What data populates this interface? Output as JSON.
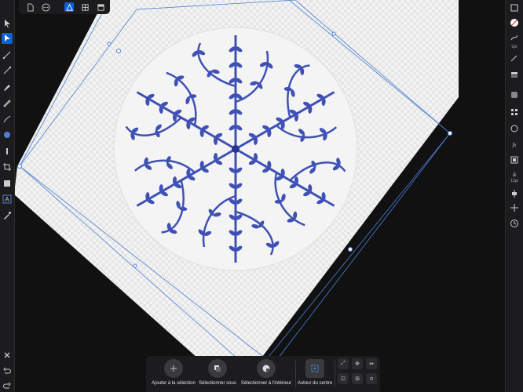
{
  "colors": {
    "accent": "#3b82f6",
    "ornament": "#3f51b5",
    "panel": "#1c1c1e",
    "canvas": "#111111"
  },
  "left_toolbar": {
    "tools": [
      "move-tool-icon",
      "node-tool-icon",
      "corner-tool-icon",
      "point-transform-icon",
      "pen-tool-icon",
      "pencil-tool-icon",
      "vector-brush-icon",
      "fill-tool-icon",
      "transparency-tool-icon",
      "crop-tool-icon",
      "rectangle-tool-icon",
      "text-tool-icon",
      "color-picker-icon"
    ],
    "bottom": [
      "close-icon",
      "undo-icon",
      "redo-icon"
    ]
  },
  "top_toolbar": {
    "tools": [
      "document-icon",
      "more-icon",
      "persona-icon",
      "grid-icon",
      "view-icon"
    ]
  },
  "right_panel": {
    "stroke_size": "0pt",
    "text_size": "12pt"
  },
  "context_bar": {
    "buttons": [
      {
        "label": "Ajouter à la sélection",
        "icon": "plus-icon"
      },
      {
        "label": "Sélectionner sous",
        "icon": "select-under-icon"
      },
      {
        "label": "Sélectionner à l'intérieur",
        "icon": "select-inside-icon"
      },
      {
        "label": "Autour du centre",
        "icon": "transform-center-icon"
      }
    ]
  }
}
